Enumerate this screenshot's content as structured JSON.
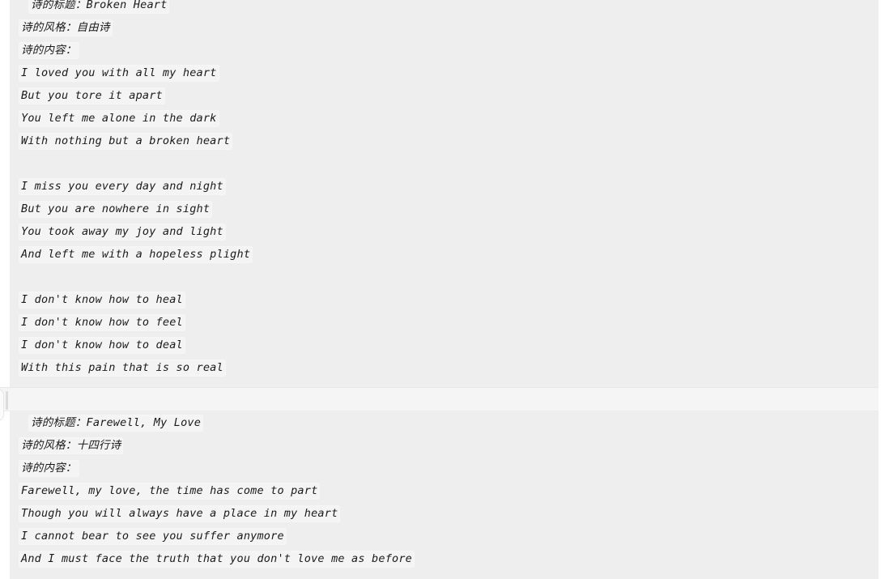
{
  "messages": [
    {
      "id": "poem-broken-heart",
      "lines": [
        {
          "text": "诗的标题：Broken Heart",
          "kind": "title",
          "indent": true
        },
        {
          "text": "诗的风格：自由诗",
          "kind": "style",
          "indent": false
        },
        {
          "text": "诗的内容：",
          "kind": "content-label",
          "indent": false
        },
        {
          "text": "I loved you with all my heart",
          "kind": "verse",
          "indent": false
        },
        {
          "text": "But you tore it apart",
          "kind": "verse",
          "indent": false
        },
        {
          "text": "You left me alone in the dark",
          "kind": "verse",
          "indent": false
        },
        {
          "text": "With nothing but a broken heart",
          "kind": "verse",
          "indent": false
        },
        {
          "text": "",
          "kind": "blank",
          "indent": false
        },
        {
          "text": "I miss you every day and night",
          "kind": "verse",
          "indent": false
        },
        {
          "text": "But you are nowhere in sight",
          "kind": "verse",
          "indent": false
        },
        {
          "text": "You took away my joy and light",
          "kind": "verse",
          "indent": false
        },
        {
          "text": "And left me with a hopeless plight",
          "kind": "verse",
          "indent": false
        },
        {
          "text": "",
          "kind": "blank",
          "indent": false
        },
        {
          "text": "I don't know how to heal",
          "kind": "verse",
          "indent": false
        },
        {
          "text": "I don't know how to feel",
          "kind": "verse",
          "indent": false
        },
        {
          "text": "I don't know how to deal",
          "kind": "verse",
          "indent": false
        },
        {
          "text": "With this pain that is so real",
          "kind": "verse",
          "indent": false
        }
      ]
    },
    {
      "id": "poem-farewell-my-love",
      "lines": [
        {
          "text": "诗的标题：Farewell, My Love",
          "kind": "title",
          "indent": true
        },
        {
          "text": "诗的风格：十四行诗",
          "kind": "style",
          "indent": false
        },
        {
          "text": "诗的内容：",
          "kind": "content-label",
          "indent": false
        },
        {
          "text": "Farewell, my love, the time has come to part",
          "kind": "verse",
          "indent": false
        },
        {
          "text": "Though you will always have a place in my heart",
          "kind": "verse",
          "indent": false
        },
        {
          "text": "I cannot bear to see you suffer anymore",
          "kind": "verse",
          "indent": false
        },
        {
          "text": "And I must face the truth that you don't love me as before",
          "kind": "verse",
          "indent": false
        }
      ]
    }
  ],
  "colors": {
    "page_background": "#ffffff",
    "message_background": "#eeeeee",
    "divider_background": "#f5f5f5",
    "text": "#1a1a1a",
    "line_highlight": "#f4f4f4"
  }
}
